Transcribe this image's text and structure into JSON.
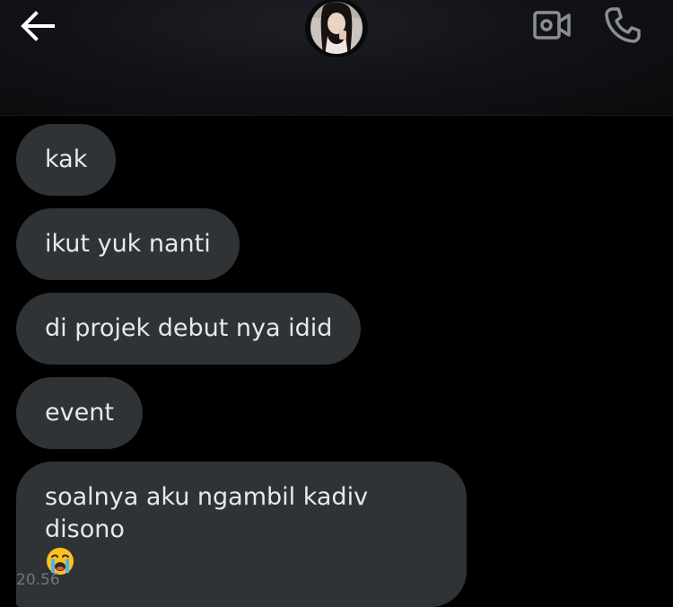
{
  "header": {
    "back_icon": "arrow-left-icon",
    "avatar_icon": "profile-photo",
    "video_icon": "video-camera-icon",
    "call_icon": "phone-icon"
  },
  "messages": [
    {
      "text": "kak"
    },
    {
      "text": "ikut yuk nanti"
    },
    {
      "text": "di projek debut nya idid"
    },
    {
      "text": "event"
    },
    {
      "text": "soalnya aku ngambil kadiv disono",
      "emoji": "loudly-crying-face-icon"
    }
  ],
  "timestamp": "20.56",
  "colors": {
    "background": "#000000",
    "bubble": "#2f3336",
    "text": "#e7e9ea",
    "muted": "#71767b"
  }
}
